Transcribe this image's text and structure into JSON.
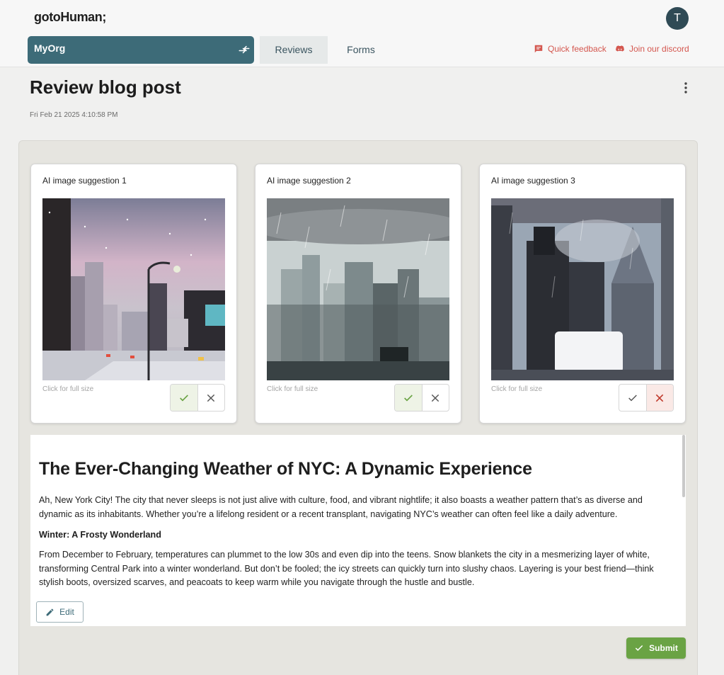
{
  "app": {
    "logo": "gotoHuman;",
    "avatar_initial": "T"
  },
  "org": {
    "name": "MyOrg",
    "swap_icon": "swap-arrows-icon",
    "settings_icon": "gear-icon"
  },
  "nav": {
    "tabs": [
      {
        "label": "Reviews",
        "active": true
      },
      {
        "label": "Forms",
        "active": false
      }
    ],
    "links": [
      {
        "label": "Quick feedback",
        "icon": "feedback-icon"
      },
      {
        "label": "Join our discord",
        "icon": "discord-icon"
      }
    ]
  },
  "page": {
    "title": "Review blog post",
    "date": "Fri Feb 21 2025 4:10:58 PM",
    "menu_icon": "more-vertical-icon"
  },
  "suggestions": [
    {
      "title": "AI image suggestion 1",
      "hint": "Click for full size",
      "state": "approved"
    },
    {
      "title": "AI image suggestion 2",
      "hint": "Click for full size",
      "state": "approved"
    },
    {
      "title": "AI image suggestion 3",
      "hint": "Click for full size",
      "state": "rejected"
    }
  ],
  "post": {
    "title": "The Ever-Changing Weather of NYC: A Dynamic Experience",
    "intro": "Ah, New York City! The city that never sleeps is not just alive with culture, food, and vibrant nightlife; it also boasts a weather pattern that’s as diverse and dynamic as its inhabitants. Whether you’re a lifelong resident or a recent transplant, navigating NYC’s weather can often feel like a daily adventure.",
    "section_heading": "Winter: A Frosty Wonderland",
    "section_text": "From December to February, temperatures can plummet to the low 30s and even dip into the teens. Snow blankets the city in a mesmerizing layer of white, transforming Central Park into a winter wonderland. But don’t be fooled; the icy streets can quickly turn into slushy chaos. Layering is your best friend—think stylish boots, oversized scarves, and peacoats to keep warm while you navigate through the hustle and bustle."
  },
  "actions": {
    "edit_label": "Edit",
    "submit_label": "Submit"
  },
  "colors": {
    "org_bg": "#3d6b78",
    "link": "#d4574f",
    "approve": "#6aa344",
    "reject": "#c0392b",
    "avatar": "#2f4a55"
  }
}
